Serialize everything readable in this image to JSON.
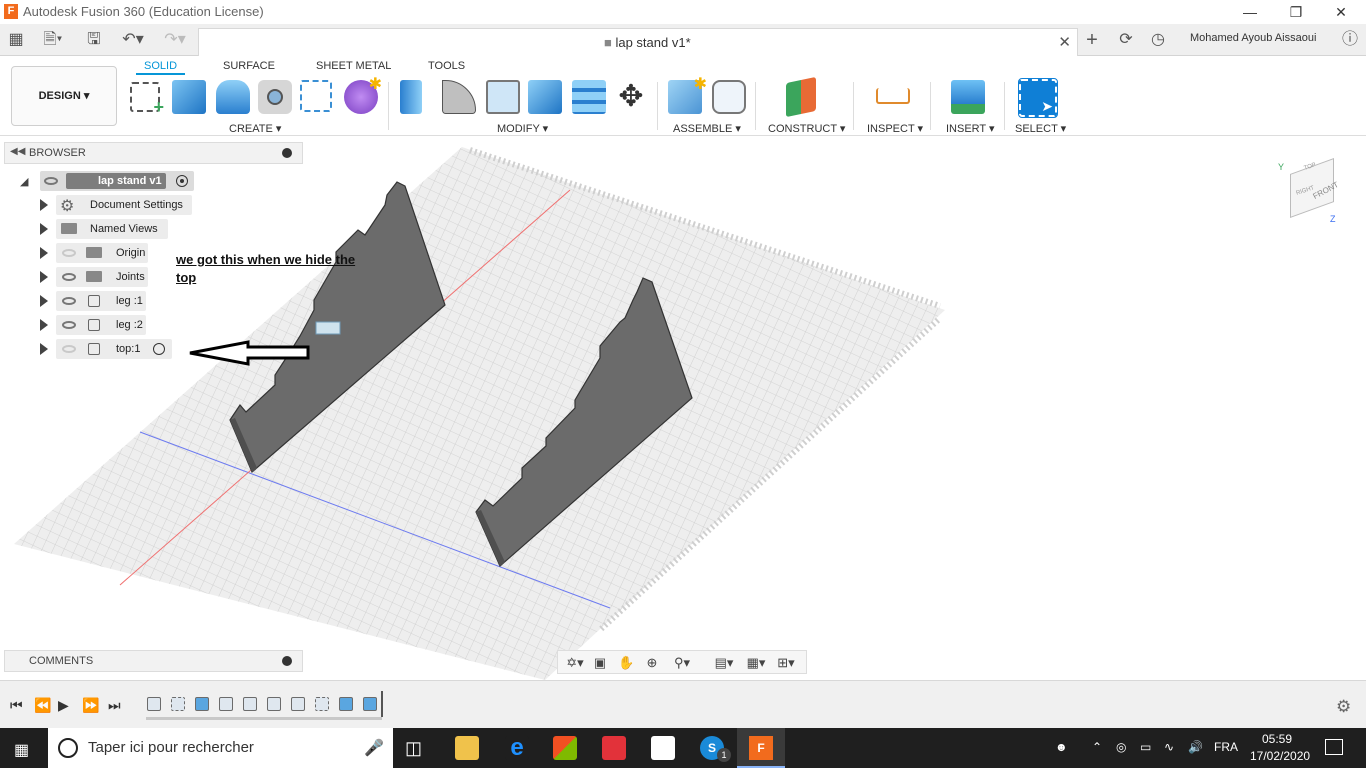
{
  "window": {
    "title": "Autodesk Fusion 360 (Education License)",
    "logo_letter": "F"
  },
  "document_tab": {
    "title": "lap stand v1*"
  },
  "user": {
    "name": "Mohamed Ayoub Aissaoui"
  },
  "workspace": {
    "label": "DESIGN"
  },
  "ribbon": {
    "tabs": [
      "SOLID",
      "SURFACE",
      "SHEET METAL",
      "TOOLS"
    ],
    "active_tab": "SOLID",
    "groups": [
      "CREATE",
      "MODIFY",
      "ASSEMBLE",
      "CONSTRUCT",
      "INSPECT",
      "INSERT",
      "SELECT"
    ]
  },
  "browser": {
    "title": "BROWSER",
    "root": "lap stand v1",
    "items": [
      {
        "label": "Document Settings",
        "icon": "gear-icon",
        "visible": null
      },
      {
        "label": "Named Views",
        "icon": "folder-icon",
        "visible": null
      },
      {
        "label": "Origin",
        "icon": "folder-icon",
        "visible": false
      },
      {
        "label": "Joints",
        "icon": "folder-icon",
        "visible": true
      },
      {
        "label": "leg :1",
        "icon": "body-icon",
        "visible": true
      },
      {
        "label": "leg :2",
        "icon": "body-icon",
        "visible": true
      },
      {
        "label": "top:1",
        "icon": "body-icon",
        "visible": false
      }
    ]
  },
  "annotation": {
    "text": "we got this when we hide the top"
  },
  "comments": {
    "title": "COMMENTS"
  },
  "viewcube": {
    "face_front": "FRONT",
    "face_top": "TOP",
    "face_right": "RIGHT",
    "axis_x": "X",
    "axis_y": "Y",
    "axis_z": "Z"
  },
  "taskbar": {
    "search_placeholder": "Taper ici pour rechercher",
    "language": "FRA",
    "time": "05:59",
    "date": "17/02/2020",
    "skype_badge": "1"
  },
  "colors": {
    "accent": "#0696d7",
    "part": "#6b6b6b",
    "grid": "#c9c9c9"
  }
}
